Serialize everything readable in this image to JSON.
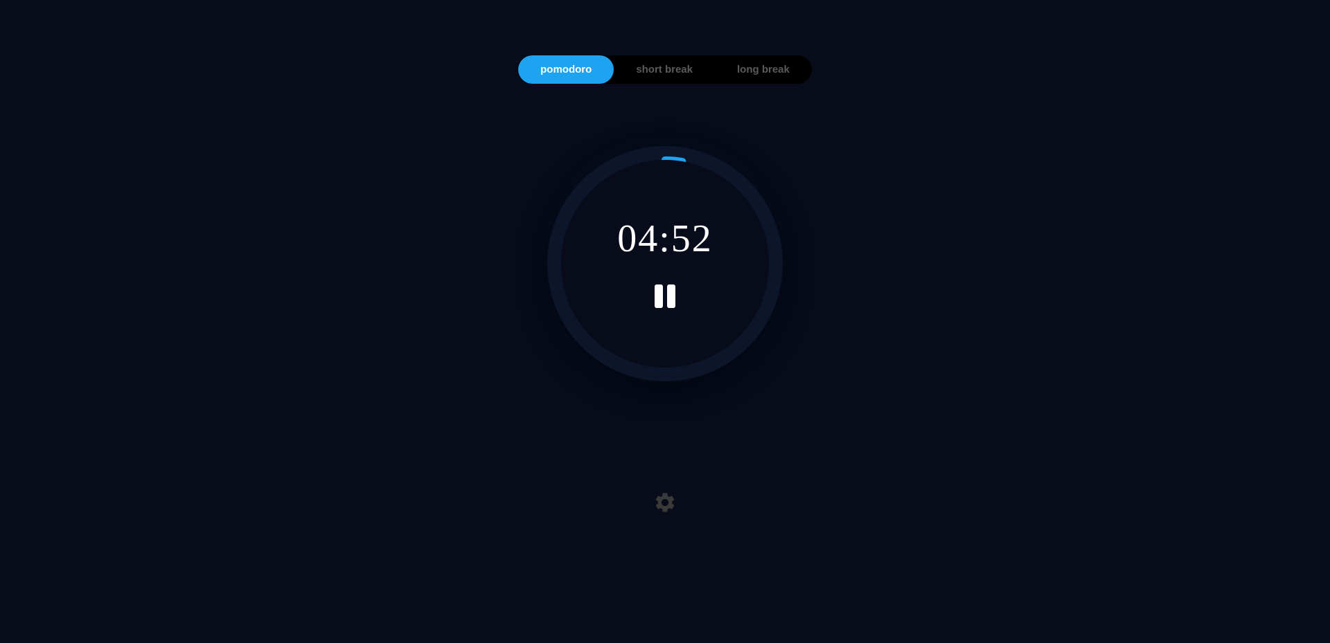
{
  "tabs": {
    "pomodoro": {
      "label": "pomodoro",
      "active": true
    },
    "short_break": {
      "label": "short break",
      "active": false
    },
    "long_break": {
      "label": "long break",
      "active": false
    }
  },
  "timer": {
    "display": "04:52",
    "progress_percent": 2.7,
    "state": "running"
  },
  "colors": {
    "accent": "#1ea3f0",
    "background": "#070b1a",
    "ring_bg": "#0c1529",
    "inactive_text": "#5a5a5a"
  },
  "icons": {
    "pause": "pause-icon",
    "settings": "gear-icon"
  }
}
